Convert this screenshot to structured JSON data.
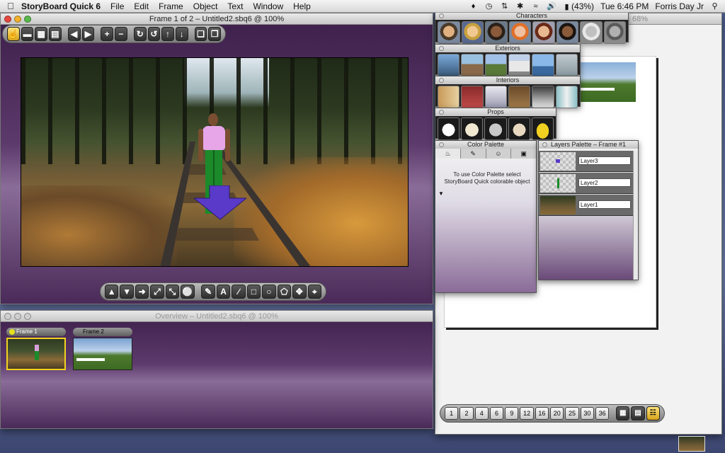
{
  "menubar": {
    "app_name": "StoryBoard Quick 6",
    "items": [
      "File",
      "Edit",
      "Frame",
      "Object",
      "Text",
      "Window",
      "Help"
    ],
    "battery": "(43%)",
    "clock": "Tue 6:46 PM",
    "user": "Forris Day Jr"
  },
  "main_window": {
    "title": "Frame 1 of 2 – Untitled2.sbq6 @ 100%"
  },
  "overview_window": {
    "title": "Overview – Untitled2.sbq6 @ 100%",
    "frames": [
      {
        "label": "Frame 1",
        "selected": true
      },
      {
        "label": "Frame 2",
        "selected": false
      }
    ]
  },
  "print_window": {
    "zoom": "68%"
  },
  "palettes": {
    "characters": "Characters",
    "exteriors": "Exteriors",
    "interiors": "Interiors",
    "props": "Props",
    "color_palette": "Color Palette",
    "color_message": "To use Color Palette select StoryBoard Quick colorable object",
    "layers_palette": "Layers Palette – Frame #1"
  },
  "layers": [
    {
      "name": "Layer3"
    },
    {
      "name": "Layer2"
    },
    {
      "name": "Layer1"
    }
  ],
  "frames_per_page": [
    "1",
    "2",
    "4",
    "6",
    "9",
    "12",
    "16",
    "20",
    "25",
    "30",
    "36"
  ],
  "colors": {
    "accent_yellow": "#f2d21e",
    "purple_dark": "#3d1f4a",
    "purple_light": "#8a6c98"
  }
}
